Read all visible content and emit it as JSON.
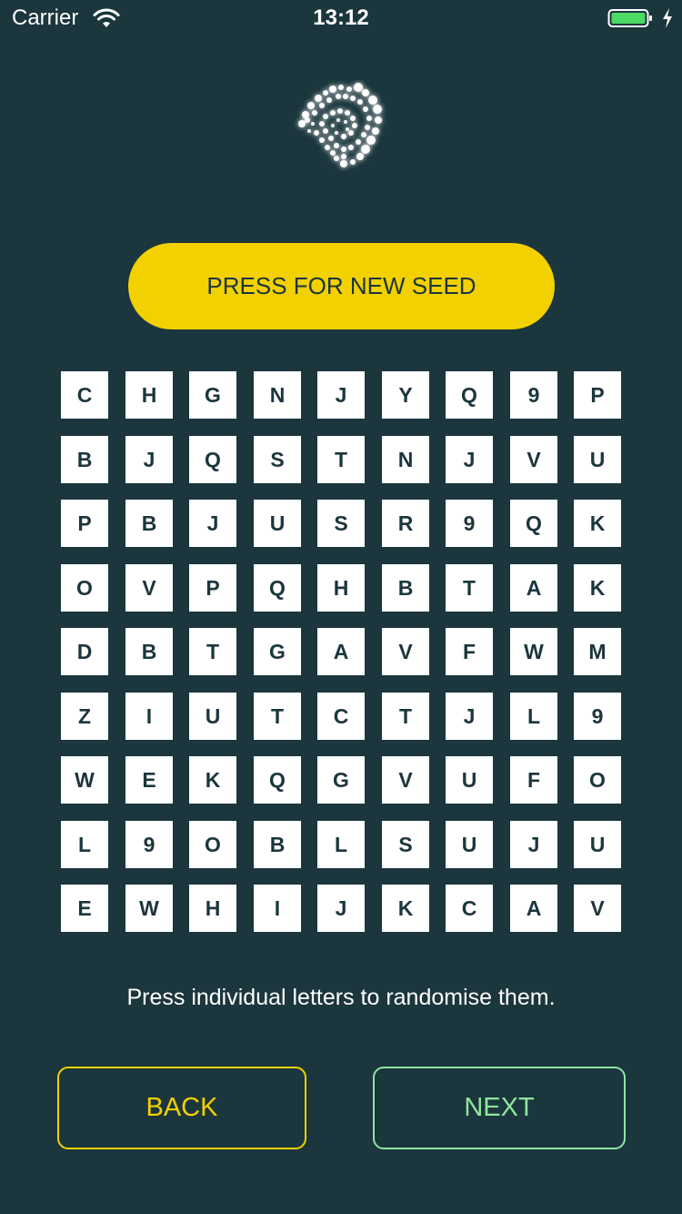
{
  "status": {
    "carrier": "Carrier",
    "time": "13:12"
  },
  "icons": {
    "wifi": "wifi-icon",
    "battery": "battery-icon",
    "charging": "charging-bolt-icon",
    "logo": "iota-logo-icon"
  },
  "colors": {
    "background": "#1b363d",
    "accent_yellow": "#f3d000",
    "accent_green": "#8ee69f",
    "battery_green": "#4cd964"
  },
  "seed_button": {
    "label": "PRESS FOR NEW SEED"
  },
  "seed_grid": {
    "rows": [
      [
        "C",
        "H",
        "G",
        "N",
        "J",
        "Y",
        "Q",
        "9",
        "P"
      ],
      [
        "B",
        "J",
        "Q",
        "S",
        "T",
        "N",
        "J",
        "V",
        "U"
      ],
      [
        "P",
        "B",
        "J",
        "U",
        "S",
        "R",
        "9",
        "Q",
        "K"
      ],
      [
        "O",
        "V",
        "P",
        "Q",
        "H",
        "B",
        "T",
        "A",
        "K"
      ],
      [
        "D",
        "B",
        "T",
        "G",
        "A",
        "V",
        "F",
        "W",
        "M"
      ],
      [
        "Z",
        "I",
        "U",
        "T",
        "C",
        "T",
        "J",
        "L",
        "9"
      ],
      [
        "W",
        "E",
        "K",
        "Q",
        "G",
        "V",
        "U",
        "F",
        "O"
      ],
      [
        "L",
        "9",
        "O",
        "B",
        "L",
        "S",
        "U",
        "J",
        "U"
      ],
      [
        "E",
        "W",
        "H",
        "I",
        "J",
        "K",
        "C",
        "A",
        "V"
      ]
    ]
  },
  "hint": "Press individual letters to randomise them.",
  "nav": {
    "back_label": "BACK",
    "next_label": "NEXT"
  }
}
